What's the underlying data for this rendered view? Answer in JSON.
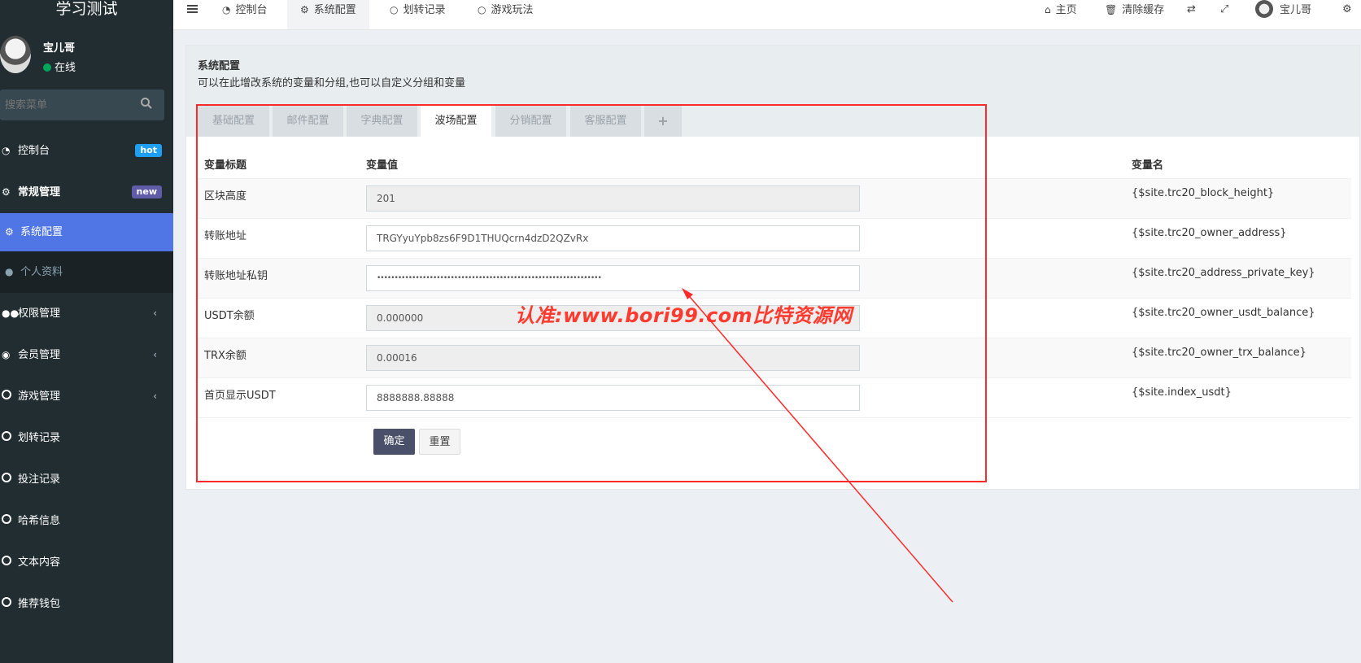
{
  "sidebar": {
    "brand": "学习测试",
    "user": {
      "name": "宝儿哥",
      "status": "在线"
    },
    "search_placeholder": "搜索菜单",
    "items": [
      {
        "label": "控制台",
        "icon": "dashboard-icon",
        "badge": "hot"
      },
      {
        "label": "常规管理",
        "icon": "cogs-icon",
        "badge": "new"
      },
      {
        "label": "系统配置",
        "icon": "gear-icon",
        "active": true
      },
      {
        "label": "个人资料",
        "icon": "user-icon",
        "sub": true
      },
      {
        "label": "权限管理",
        "icon": "group-icon",
        "chevron": "‹"
      },
      {
        "label": "会员管理",
        "icon": "user-circle-icon",
        "chevron": "‹"
      },
      {
        "label": "游戏管理",
        "icon": "circle-icon",
        "chevron": "‹"
      },
      {
        "label": "划转记录",
        "icon": "circle-icon"
      },
      {
        "label": "投注记录",
        "icon": "circle-icon"
      },
      {
        "label": "哈希信息",
        "icon": "circle-icon"
      },
      {
        "label": "文本内容",
        "icon": "circle-icon"
      },
      {
        "label": "推荐钱包",
        "icon": "circle-icon"
      }
    ]
  },
  "topnav": {
    "tabs": [
      {
        "label": "控制台",
        "icon": "dashboard-icon"
      },
      {
        "label": "系统配置",
        "icon": "gear-icon",
        "active": true
      },
      {
        "label": "划转记录",
        "icon": "circle-icon"
      },
      {
        "label": "游戏玩法",
        "icon": "circle-icon"
      }
    ],
    "right": {
      "home": "主页",
      "clear_cache": "清除缓存",
      "user": "宝儿哥"
    }
  },
  "page": {
    "title": "系统配置",
    "description": "可以在此增改系统的变量和分组,也可以自定义分组和变量",
    "tabs": [
      "基础配置",
      "邮件配置",
      "字典配置",
      "波场配置",
      "分销配置",
      "客服配置",
      "+"
    ],
    "active_tab": "波场配置",
    "columns": {
      "title": "变量标题",
      "value": "变量值",
      "name": "变量名"
    },
    "rows": [
      {
        "title": "区块高度",
        "value": "201",
        "name": "{$site.trc20_block_height}",
        "readonly": true
      },
      {
        "title": "转账地址",
        "value": "TRGYyuYpb8zs6F9D1THUQcrn4dzD2QZvRx",
        "name": "{$site.trc20_owner_address}",
        "readonly": false
      },
      {
        "title": "转账地址私钥",
        "value": "••••••••••••••••••••••••••••••••••••••••••••••••••••••••••••••••",
        "name": "{$site.trc20_address_private_key}",
        "readonly": false
      },
      {
        "title": "USDT余额",
        "value": "0.000000",
        "name": "{$site.trc20_owner_usdt_balance}",
        "readonly": true
      },
      {
        "title": "TRX余额",
        "value": "0.00016",
        "name": "{$site.trc20_owner_trx_balance}",
        "readonly": true
      },
      {
        "title": "首页显示USDT",
        "value": "8888888.88888",
        "name": "{$site.index_usdt}",
        "readonly": false
      }
    ],
    "buttons": {
      "confirm": "确定",
      "reset": "重置"
    }
  },
  "annotation": {
    "watermark": "认准:www.bori99.com比特资源网",
    "color": "#ff2a2a"
  }
}
